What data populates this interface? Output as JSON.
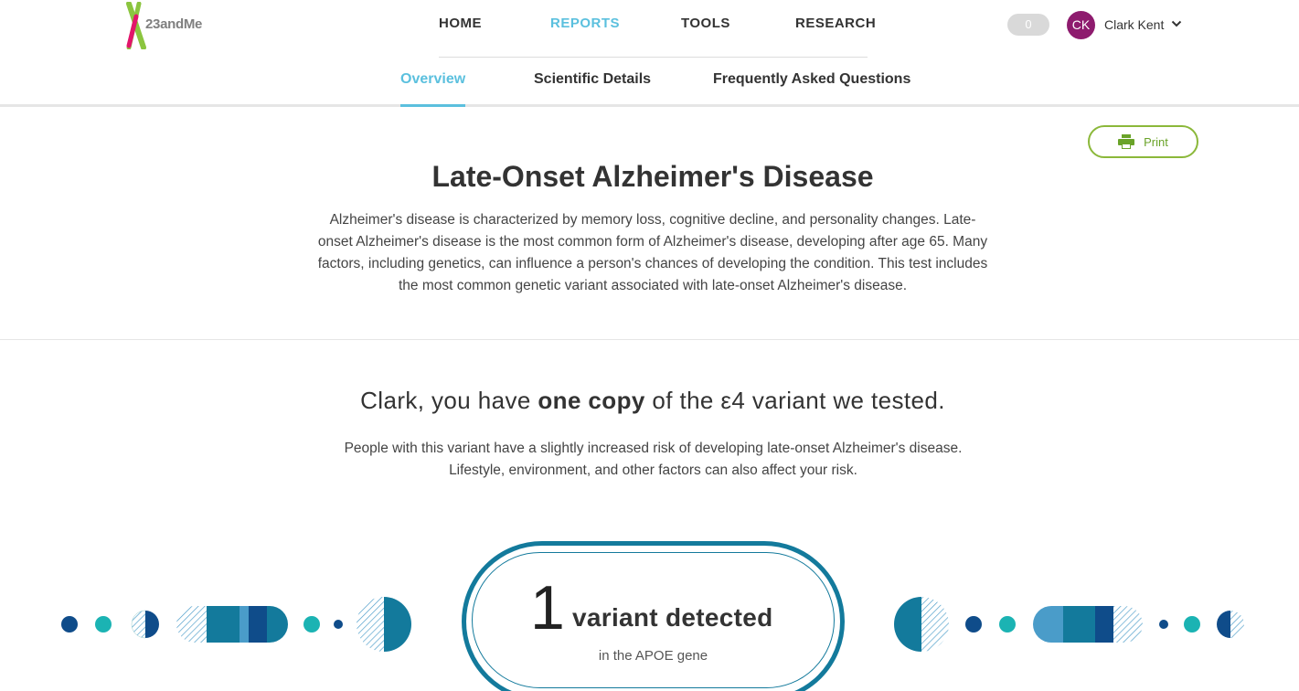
{
  "header": {
    "logo_text": "23andMe",
    "nav": [
      {
        "label": "HOME",
        "active": false
      },
      {
        "label": "REPORTS",
        "active": true
      },
      {
        "label": "TOOLS",
        "active": false
      },
      {
        "label": "RESEARCH",
        "active": false
      }
    ],
    "notification_count": "0",
    "user_initials": "CK",
    "user_name": "Clark Kent",
    "avatar_color": "#8e1b6e",
    "accent_color": "#5bc0de"
  },
  "subnav": [
    {
      "label": "Overview",
      "active": true
    },
    {
      "label": "Scientific Details",
      "active": false
    },
    {
      "label": "Frequently Asked Questions",
      "active": false
    }
  ],
  "report": {
    "print_label": "Print",
    "title": "Late-Onset Alzheimer's Disease",
    "intro_lines": [
      "Alzheimer's disease is characterized by memory loss, cognitive decline, and personality changes. Late-",
      "onset Alzheimer's disease is the most common form of Alzheimer's disease, developing after age 65. Many",
      "factors, including genetics, can influence a person's chances of developing the condition. This test includes",
      "the most common genetic variant associated with late-onset Alzheimer's disease."
    ],
    "result_prefix": "Clark, you have ",
    "result_bold": "one copy",
    "result_suffix": " of the ε4 variant we tested.",
    "result_sub_lines": [
      "People with this variant have a slightly increased risk of developing late-onset Alzheimer's disease.",
      "Lifestyle, environment, and other factors can also affect your risk."
    ],
    "variant_count": "1",
    "variant_label": "variant detected",
    "gene_text": "in the APOE gene"
  }
}
